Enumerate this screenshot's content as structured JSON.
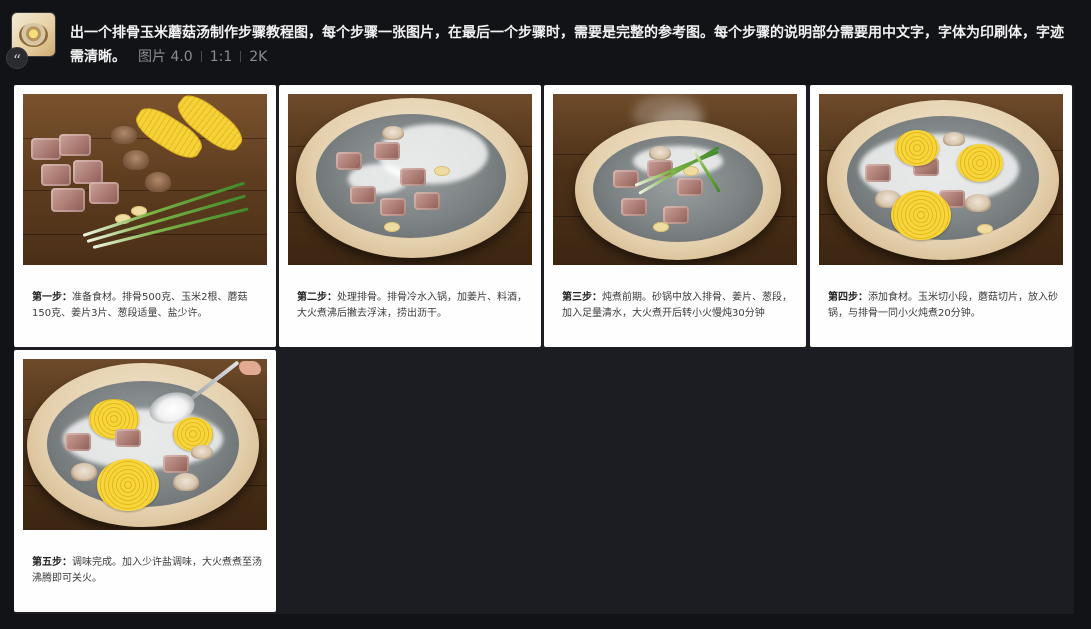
{
  "message": {
    "text": "出一个排骨玉米蘑菇汤制作步骤教程图，每个步骤一张图片，在最后一个步骤时，需要是完整的参考图。每个步骤的说明部分需要用中文字，字体为印刷体，字迹需清晰。",
    "meta_model": "图片 4.0",
    "meta_ratio": "1:1",
    "meta_resolution": "2K",
    "avatar_icon": "quote-icon"
  },
  "steps": [
    {
      "label": "第一步：",
      "text": "准备食材。排骨500克、玉米2根、蘑菇150克、姜片3片、葱段适量、盐少许。"
    },
    {
      "label": "第二步：",
      "text": "处理排骨。排骨冷水入锅，加姜片、料酒，大火煮沸后撇去浮沫，捞出沥干。"
    },
    {
      "label": "第三步：",
      "text": "炖煮前期。砂锅中放入排骨、姜片、葱段，加入足量清水，大火煮开后转小火慢炖30分钟"
    },
    {
      "label": "第四步：",
      "text": "添加食材。玉米切小段，蘑菇切片，放入砂锅，与排骨一同小火炖煮20分钟。"
    },
    {
      "label": "第五步：",
      "text": "调味完成。加入少许盐调味，大火煮煮至汤沸腾即可关火。"
    }
  ]
}
